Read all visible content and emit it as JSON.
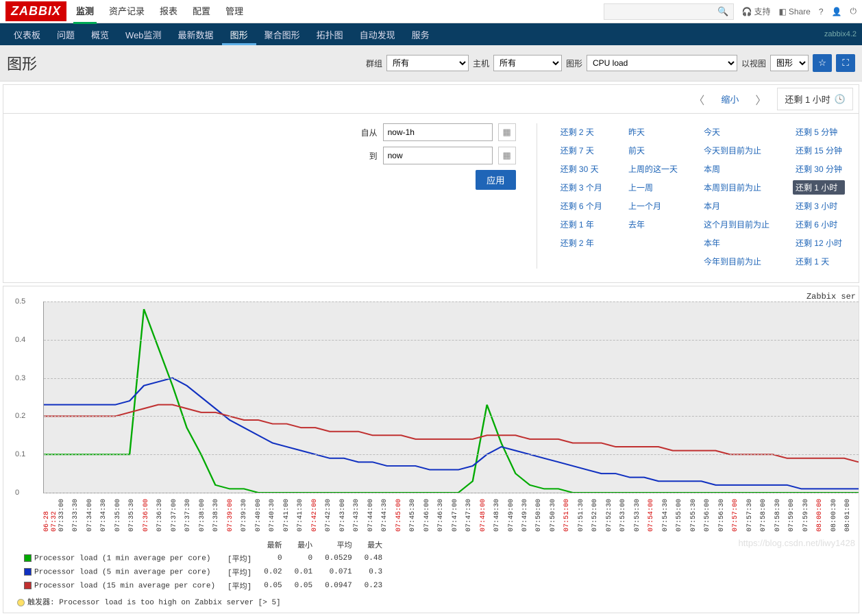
{
  "logo": "ZABBIX",
  "topnav": [
    "监测",
    "资产记录",
    "报表",
    "配置",
    "管理"
  ],
  "topnav_active": 0,
  "top_right": {
    "support": "支持",
    "share": "Share"
  },
  "version": "zabbix4.2",
  "subnav": [
    "仪表板",
    "问题",
    "概览",
    "Web监测",
    "最新数据",
    "图形",
    "聚合图形",
    "拓扑图",
    "自动发现",
    "服务"
  ],
  "subnav_active": 5,
  "page_title": "图形",
  "filters": {
    "group_label": "群组",
    "group_value": "所有",
    "host_label": "主机",
    "host_value": "所有",
    "graph_label": "图形",
    "graph_value": "CPU load",
    "view_label": "以视图",
    "view_value": "图形"
  },
  "tabbar": {
    "zoom": "缩小",
    "range": "还剩 1 小时"
  },
  "timeform": {
    "from_label": "自从",
    "from_value": "now-1h",
    "to_label": "到",
    "to_value": "now",
    "apply": "应用"
  },
  "presets_cols": [
    [
      "还剩 2 天",
      "还剩 7 天",
      "还剩 30 天",
      "还剩 3 个月",
      "还剩 6 个月",
      "还剩 1 年",
      "还剩 2 年"
    ],
    [
      "昨天",
      "前天",
      "上周的这一天",
      "上一周",
      "上一个月",
      "去年",
      ""
    ],
    [
      "今天",
      "今天到目前为止",
      "本周",
      "本周到目前为止",
      "本月",
      "这个月到目前为止",
      "本年",
      "今年到目前为止"
    ],
    [
      "还剩 5 分钟",
      "还剩 15 分钟",
      "还剩 30 分钟",
      "还剩 1 小时",
      "还剩 3 小时",
      "还剩 6 小时",
      "还剩 12 小时",
      "还剩 1 天"
    ]
  ],
  "preset_selected": "还剩 1 小时",
  "chart_data": {
    "type": "line",
    "title": "Zabbix ser",
    "ylabel": "",
    "ylim": [
      0,
      0.5
    ],
    "yticks": [
      0,
      0.1,
      0.2,
      0.3,
      0.4,
      0.5
    ],
    "x_times": [
      "06-28 07:32",
      "07:33:00",
      "07:33:30",
      "07:34:00",
      "07:34:30",
      "07:35:00",
      "07:35:30",
      "07:36:00",
      "07:36:30",
      "07:37:00",
      "07:37:30",
      "07:38:00",
      "07:38:30",
      "07:39:00",
      "07:39:30",
      "07:40:00",
      "07:40:30",
      "07:41:00",
      "07:41:30",
      "07:42:00",
      "07:42:30",
      "07:43:00",
      "07:43:30",
      "07:44:00",
      "07:44:30",
      "07:45:00",
      "07:45:30",
      "07:46:00",
      "07:46:30",
      "07:47:00",
      "07:47:30",
      "07:48:00",
      "07:48:30",
      "07:49:00",
      "07:49:30",
      "07:50:00",
      "07:50:30",
      "07:51:00",
      "07:51:30",
      "07:52:00",
      "07:52:30",
      "07:53:00",
      "07:53:30",
      "07:54:00",
      "07:54:30",
      "07:55:00",
      "07:55:30",
      "07:56:00",
      "07:56:30",
      "07:57:00",
      "07:57:30",
      "07:58:00",
      "07:58:30",
      "07:59:00",
      "07:59:30",
      "08:00:00",
      "08:00:30",
      "08:01:00"
    ],
    "x_red": [
      0,
      7,
      13,
      19,
      25,
      31,
      37,
      43,
      49,
      55
    ],
    "series": [
      {
        "name": "Processor load (1 min average per core)",
        "color": "#00aa00",
        "values": [
          0.1,
          0.1,
          0.1,
          0.1,
          0.1,
          0.1,
          0.1,
          0.48,
          0.38,
          0.28,
          0.17,
          0.1,
          0.02,
          0.01,
          0.01,
          0.0,
          0.0,
          0.0,
          0.0,
          0.0,
          0.0,
          0.0,
          0.0,
          0.0,
          0.0,
          0.0,
          0.0,
          0.0,
          0.0,
          0.0,
          0.03,
          0.23,
          0.13,
          0.05,
          0.02,
          0.01,
          0.01,
          0.0,
          0.0,
          0.0,
          0.0,
          0.0,
          0.0,
          0.0,
          0.0,
          0.0,
          0.0,
          0.0,
          0.0,
          0.0,
          0.0,
          0.0,
          0.0,
          0.0,
          0.0,
          0.0,
          0.0,
          0.0
        ]
      },
      {
        "name": "Processor load (5 min average per core)",
        "color": "#1030c0",
        "values": [
          0.23,
          0.23,
          0.23,
          0.23,
          0.23,
          0.23,
          0.24,
          0.28,
          0.29,
          0.3,
          0.28,
          0.25,
          0.22,
          0.19,
          0.17,
          0.15,
          0.13,
          0.12,
          0.11,
          0.1,
          0.09,
          0.09,
          0.08,
          0.08,
          0.07,
          0.07,
          0.07,
          0.06,
          0.06,
          0.06,
          0.07,
          0.1,
          0.12,
          0.11,
          0.1,
          0.09,
          0.08,
          0.07,
          0.06,
          0.05,
          0.05,
          0.04,
          0.04,
          0.03,
          0.03,
          0.03,
          0.03,
          0.02,
          0.02,
          0.02,
          0.02,
          0.02,
          0.02,
          0.01,
          0.01,
          0.01,
          0.01,
          0.01
        ]
      },
      {
        "name": "Processor load (15 min average per core)",
        "color": "#c03030",
        "values": [
          0.2,
          0.2,
          0.2,
          0.2,
          0.2,
          0.2,
          0.21,
          0.22,
          0.23,
          0.23,
          0.22,
          0.21,
          0.21,
          0.2,
          0.19,
          0.19,
          0.18,
          0.18,
          0.17,
          0.17,
          0.16,
          0.16,
          0.16,
          0.15,
          0.15,
          0.15,
          0.14,
          0.14,
          0.14,
          0.14,
          0.14,
          0.15,
          0.15,
          0.15,
          0.14,
          0.14,
          0.14,
          0.13,
          0.13,
          0.13,
          0.12,
          0.12,
          0.12,
          0.12,
          0.11,
          0.11,
          0.11,
          0.11,
          0.1,
          0.1,
          0.1,
          0.1,
          0.09,
          0.09,
          0.09,
          0.09,
          0.09,
          0.08
        ]
      }
    ],
    "legend_head": [
      "最新",
      "最小",
      "平均",
      "最大"
    ],
    "legend_rows": [
      {
        "agg": "[平均]",
        "latest": "0",
        "min": "0",
        "avg": "0.0529",
        "max": "0.48"
      },
      {
        "agg": "[平均]",
        "latest": "0.02",
        "min": "0.01",
        "avg": "0.071",
        "max": "0.3"
      },
      {
        "agg": "[平均]",
        "latest": "0.05",
        "min": "0.05",
        "avg": "0.0947",
        "max": "0.23"
      }
    ],
    "trigger": "触发器: Processor load is too high on Zabbix server   [> 5]"
  },
  "watermark": "https://blog.csdn.net/liwy1428"
}
